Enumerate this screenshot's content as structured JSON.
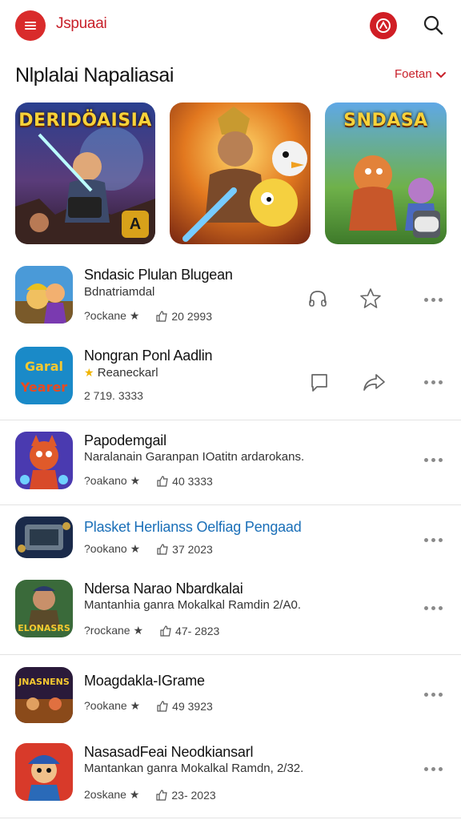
{
  "header": {
    "app_title": "Jspuaai",
    "icons": [
      "menu-icon",
      "profile-icon",
      "search-icon"
    ]
  },
  "section": {
    "title": "Nlplalai Napaliasai",
    "action_label": "Foetan"
  },
  "featured": [
    {
      "title": "DERIDÖAISIA",
      "badge": "A"
    },
    {
      "title": "",
      "badge": ""
    },
    {
      "title": "SNDASA",
      "badge": ""
    }
  ],
  "items": [
    {
      "title": "Sndasic Plulan Blugean",
      "subtitle": "Bdnatriamdal",
      "meta_left": "?ockane ★",
      "meta_right": "20  2993",
      "actions": [
        "headphones-icon",
        "star-icon",
        "more-icon"
      ]
    },
    {
      "title": "Nongran Ponl Aadlin",
      "subtitle": "Reaneckarl",
      "meta_left": "2  719. 3333",
      "meta_right": "",
      "actions": [
        "chat-icon",
        "share-icon",
        "more-icon"
      ]
    },
    {
      "title": "Papodemgail",
      "subtitle": "Naralanain Garanpan IOatitn ardarokans.",
      "meta_left": "?oakano ★",
      "meta_right": "40  3333",
      "actions": [
        "more-icon"
      ]
    },
    {
      "title": "Plasket Herlianss Oelfiag Pengaad",
      "subtitle": "",
      "meta_left": "?ookano ★",
      "meta_right": "37  2023",
      "actions": [
        "more-icon"
      ]
    },
    {
      "title": "Ndersa Narao Nbardkalai",
      "subtitle": "Mantanhia ganra Mokalkal Ramdin 2/A0.",
      "meta_left": "?rockane ★",
      "meta_right": "47- 2823",
      "actions": [
        "more-icon"
      ]
    },
    {
      "title": "Moagdakla-IGrame",
      "subtitle": "",
      "meta_left": "?ookane ★",
      "meta_right": "49  3923",
      "actions": [
        "more-icon"
      ]
    },
    {
      "title": "NasasadFeai Neodkiansarl",
      "subtitle": "Mantankan ganra Mokalkal Ramdn, 2/32.",
      "meta_left": "2oskane ★",
      "meta_right": "23- 2023",
      "actions": [
        "more-icon"
      ]
    }
  ],
  "colors": {
    "accent": "#d92b2b",
    "link": "#1a6fb8",
    "divider": "#e3e3e3"
  }
}
